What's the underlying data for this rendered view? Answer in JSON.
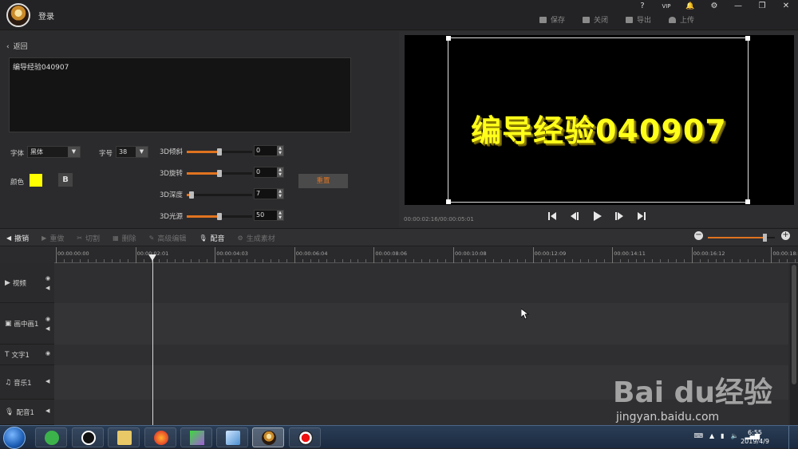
{
  "titlebar": {
    "login_label": "登录",
    "window_controls": [
      "?",
      "VIP",
      "🔔",
      "⚙",
      "—",
      "❐",
      "✕"
    ],
    "actions": [
      {
        "label": "保存",
        "icon": "save-icon"
      },
      {
        "label": "关闭",
        "icon": "exit-icon"
      },
      {
        "label": "导出",
        "icon": "export-icon"
      },
      {
        "label": "上传",
        "icon": "upload-icon"
      }
    ]
  },
  "editor": {
    "back_label": "返回",
    "text_value": "编导经验040907",
    "font_label": "字体",
    "font_value": "黑体",
    "size_label": "字号",
    "size_value": "38",
    "color_label": "颜色",
    "color_value": "#ffff00",
    "bold_label": "B",
    "reset_label": "重置",
    "sliders": [
      {
        "label": "3D倾斜",
        "value": "0",
        "level": 0.5
      },
      {
        "label": "3D旋转",
        "value": "0",
        "level": 0.5
      },
      {
        "label": "3D深度",
        "value": "7",
        "level": 0.07
      },
      {
        "label": "3D光源",
        "value": "50",
        "level": 0.5
      }
    ]
  },
  "preview": {
    "text": "编导经验040907",
    "timecode": "00:00:02:16/00:00:05:01"
  },
  "toolbar": {
    "items": [
      {
        "label": "撤销",
        "icon": "undo-icon",
        "enabled": true
      },
      {
        "label": "重做",
        "icon": "redo-icon",
        "enabled": false
      },
      {
        "label": "切割",
        "icon": "scissors-icon",
        "enabled": false
      },
      {
        "label": "删除",
        "icon": "trash-icon",
        "enabled": false
      },
      {
        "label": "高级编辑",
        "icon": "edit-icon",
        "enabled": false
      },
      {
        "label": "配音",
        "icon": "microphone-icon",
        "enabled": true
      },
      {
        "label": "生成素材",
        "icon": "generate-icon",
        "enabled": false
      }
    ],
    "zoom_minus": "−",
    "zoom_plus": "+",
    "zoom_level": 0.85
  },
  "timeline": {
    "ticks": [
      "00:00:00:00",
      "00:00:02:01",
      "00:00:04:03",
      "00:00:06:04",
      "00:00:08:06",
      "00:00:10:08",
      "00:00:12:09",
      "00:00:14:11",
      "00:00:16:12",
      "00:00:18:1"
    ],
    "tracks": [
      {
        "label": "视频",
        "icon": "video-icon",
        "controls": [
          "eye",
          "speaker"
        ]
      },
      {
        "label": "画中画1",
        "icon": "pip-icon",
        "controls": [
          "eye",
          "speaker"
        ]
      },
      {
        "label": "文字1",
        "icon": "text-icon",
        "controls": [
          "eye"
        ]
      },
      {
        "label": "音乐1",
        "icon": "music-icon",
        "controls": [
          "speaker"
        ]
      },
      {
        "label": "配音1",
        "icon": "microphone-icon",
        "controls": [
          "speaker"
        ]
      }
    ]
  },
  "watermark": {
    "logo_text": "Bai du经验",
    "url": "jingyan.baidu.com"
  },
  "taskbar": {
    "time": "6:55",
    "date": "2019/4/9",
    "tray_icons": [
      "keyboard-icon",
      "▲",
      "battery-icon",
      "volume-icon",
      "network-icon"
    ]
  }
}
